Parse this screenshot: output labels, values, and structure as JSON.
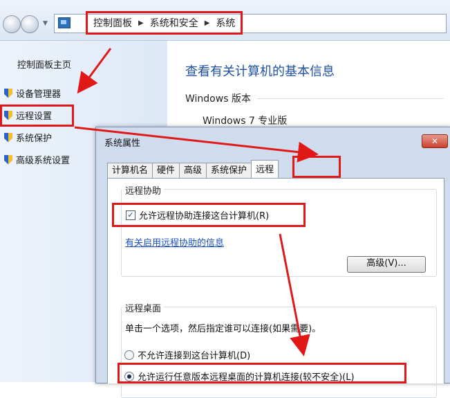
{
  "address_bar": {
    "breadcrumbs": [
      "控制面板",
      "系统和安全",
      "系统"
    ]
  },
  "sidebar": {
    "home": "控制面板主页",
    "items": [
      {
        "label": "设备管理器",
        "icon": "shield-icon"
      },
      {
        "label": "远程设置",
        "icon": "shield-icon"
      },
      {
        "label": "系统保护",
        "icon": "shield-icon"
      },
      {
        "label": "高级系统设置",
        "icon": "shield-icon"
      }
    ]
  },
  "main": {
    "title": "查看有关计算机的基本信息",
    "section_label": "Windows 版本",
    "version": "Windows 7 专业版"
  },
  "dialog": {
    "title": "系统属性",
    "close_symbol": "✕",
    "tabs": [
      "计算机名",
      "硬件",
      "高级",
      "系统保护",
      "远程"
    ],
    "active_tab": "远程",
    "remote_assistance": {
      "group_label": "远程协助",
      "checkbox_label": "允许远程协助连接这台计算机(R)",
      "checked": true,
      "help_link": "有关启用远程协助的信息",
      "advanced_button": "高级(V)..."
    },
    "remote_desktop": {
      "group_label": "远程桌面",
      "description": "单击一个选项，然后指定谁可以连接(如果需要)。",
      "options": [
        {
          "label": "不允许连接到这台计算机(D)",
          "selected": false
        },
        {
          "label": "允许运行任意版本远程桌面的计算机连接(较不安全)(L)",
          "selected": true
        }
      ]
    }
  },
  "annotations": {
    "highlight_color": "#e01818"
  }
}
